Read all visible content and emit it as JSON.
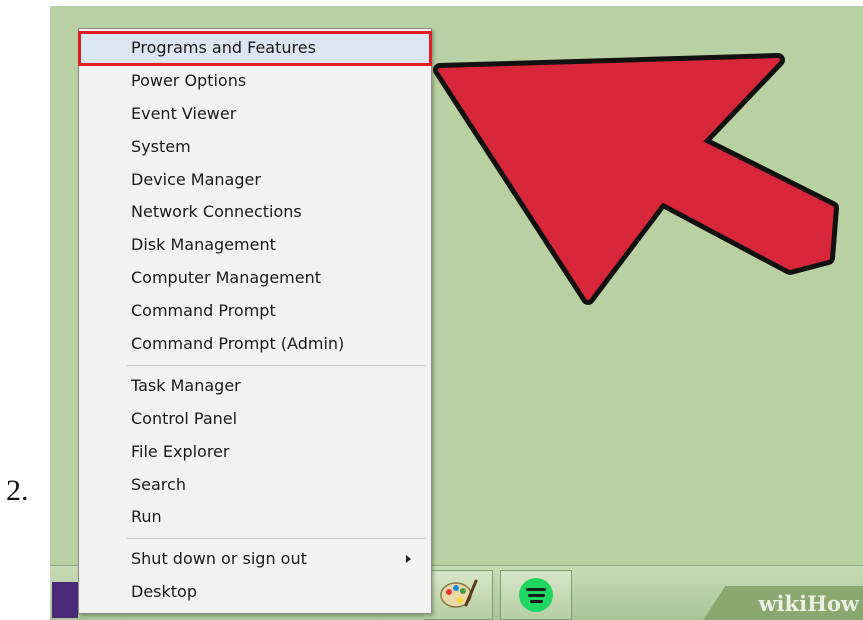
{
  "step": {
    "number": "2."
  },
  "menu": {
    "groups": [
      {
        "items": [
          {
            "label": "Programs and Features",
            "highlighted": true
          },
          {
            "label": "Power Options"
          },
          {
            "label": "Event Viewer"
          },
          {
            "label": "System"
          },
          {
            "label": "Device Manager"
          },
          {
            "label": "Network Connections"
          },
          {
            "label": "Disk Management"
          },
          {
            "label": "Computer Management"
          },
          {
            "label": "Command Prompt"
          },
          {
            "label": "Command Prompt (Admin)"
          }
        ]
      },
      {
        "items": [
          {
            "label": "Task Manager"
          },
          {
            "label": "Control Panel"
          },
          {
            "label": "File Explorer"
          },
          {
            "label": "Search"
          },
          {
            "label": "Run"
          }
        ]
      },
      {
        "items": [
          {
            "label": "Shut down or sign out",
            "has_submenu": true
          },
          {
            "label": "Desktop"
          }
        ]
      }
    ]
  },
  "taskbar": {
    "apps": [
      {
        "icon": "paint-icon"
      },
      {
        "icon": "spotify-icon"
      }
    ]
  },
  "watermark": {
    "wiki": "wiki",
    "how": "How"
  },
  "colors": {
    "desktop": "#b9d0a2",
    "highlight_border": "#e01e24",
    "arrow_fill": "#d8273a",
    "menu_background": "#f2f2f2",
    "menu_highlight": "#dbe6f2"
  }
}
